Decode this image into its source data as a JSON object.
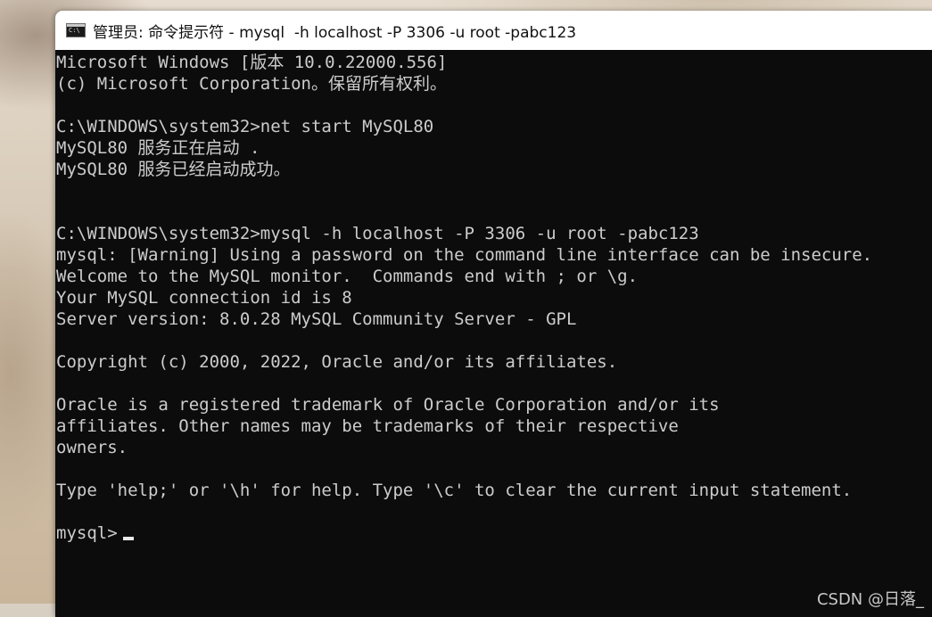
{
  "window": {
    "title": "管理员: 命令提示符 - mysql  -h localhost -P 3306 -u root -pabc123",
    "icon": "cmd-icon"
  },
  "console": {
    "lines": [
      "Microsoft Windows [版本 10.0.22000.556]",
      "(c) Microsoft Corporation。保留所有权利。",
      "",
      "C:\\WINDOWS\\system32>net start MySQL80",
      "MySQL80 服务正在启动 .",
      "MySQL80 服务已经启动成功。",
      "",
      "",
      "C:\\WINDOWS\\system32>mysql -h localhost -P 3306 -u root -pabc123",
      "mysql: [Warning] Using a password on the command line interface can be insecure.",
      "Welcome to the MySQL monitor.  Commands end with ; or \\g.",
      "Your MySQL connection id is 8",
      "Server version: 8.0.28 MySQL Community Server - GPL",
      "",
      "Copyright (c) 2000, 2022, Oracle and/or its affiliates.",
      "",
      "Oracle is a registered trademark of Oracle Corporation and/or its",
      "affiliates. Other names may be trademarks of their respective",
      "owners.",
      "",
      "Type 'help;' or '\\h' for help. Type '\\c' to clear the current input statement.",
      ""
    ],
    "prompt": "mysql>"
  },
  "watermark": "CSDN @日落_",
  "colors": {
    "console_bg": "#0c0c0c",
    "console_text": "#cccccc",
    "titlebar_bg": "#ffffff"
  }
}
